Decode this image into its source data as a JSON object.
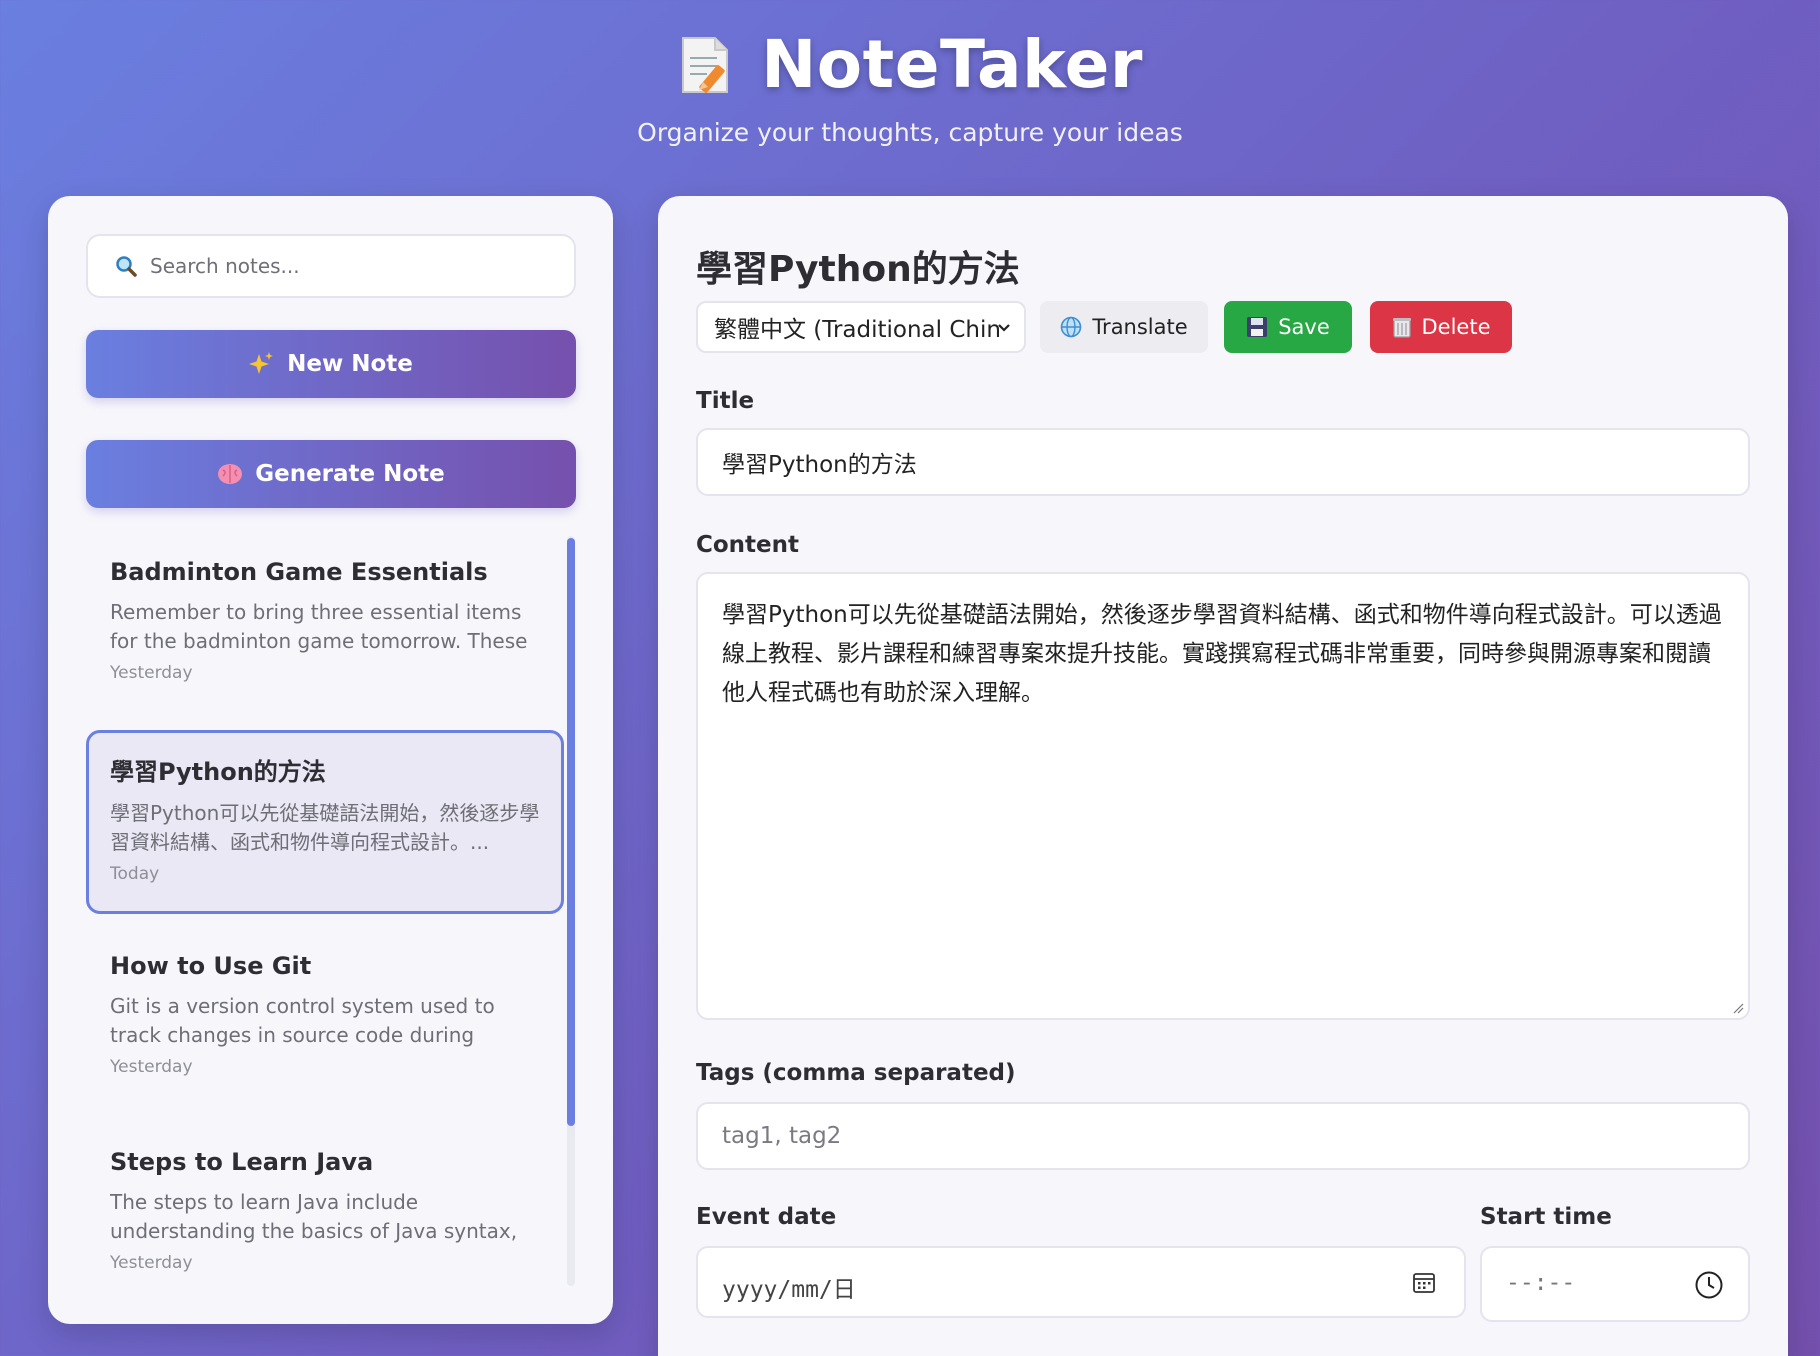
{
  "header": {
    "title": "NoteTaker",
    "subtitle": "Organize your thoughts, capture your ideas"
  },
  "sidebar": {
    "search_placeholder": "Search notes...",
    "new_note_label": "New Note",
    "generate_note_label": "Generate Note",
    "notes": [
      {
        "title": "Badminton Game Essentials",
        "excerpt": "Remember to bring three essential items for the badminton game tomorrow. These inclu...",
        "date": "Yesterday",
        "active": false
      },
      {
        "title": "學習Python的方法",
        "excerpt": "學習Python可以先從基礎語法開始，然後逐步學習資料結構、函式和物件導向程式設計。...",
        "date": "Today",
        "active": true
      },
      {
        "title": "How to Use Git",
        "excerpt": "Git is a version control system used to track changes in source code during software...",
        "date": "Yesterday",
        "active": false
      },
      {
        "title": "Steps to Learn Java",
        "excerpt": "The steps to learn Java include understanding the basics of Java syntax, setting up the...",
        "date": "Yesterday",
        "active": false
      }
    ]
  },
  "editor": {
    "heading": "學習Python的方法",
    "language_selected": "繁體中文 (Traditional Chin",
    "translate_label": "Translate",
    "save_label": "Save",
    "delete_label": "Delete",
    "title_label": "Title",
    "title_value": "學習Python的方法",
    "content_label": "Content",
    "content_value": "學習Python可以先從基礎語法開始，然後逐步學習資料結構、函式和物件導向程式設計。可以透過線上教程、影片課程和練習專案來提升技能。實踐撰寫程式碼非常重要，同時參與開源專案和閱讀他人程式碼也有助於深入理解。",
    "tags_label": "Tags (comma separated)",
    "tags_placeholder": "tag1, tag2",
    "event_date_label": "Event date",
    "event_date_placeholder": "yyyy/mm/日",
    "start_time_label": "Start time",
    "start_time_placeholder": "--:--"
  },
  "colors": {
    "accent": "#6a7fe0",
    "accent_end": "#7650ad",
    "save": "#28a745",
    "delete": "#dc3545"
  },
  "icons": {
    "logo": "memo-icon",
    "search": "magnifier-icon",
    "new_note": "sparkles-icon",
    "generate": "brain-icon",
    "translate": "globe-icon",
    "save": "floppy-disk-icon",
    "delete": "wastebasket-icon",
    "date": "calendar-icon",
    "time": "clock-icon"
  }
}
